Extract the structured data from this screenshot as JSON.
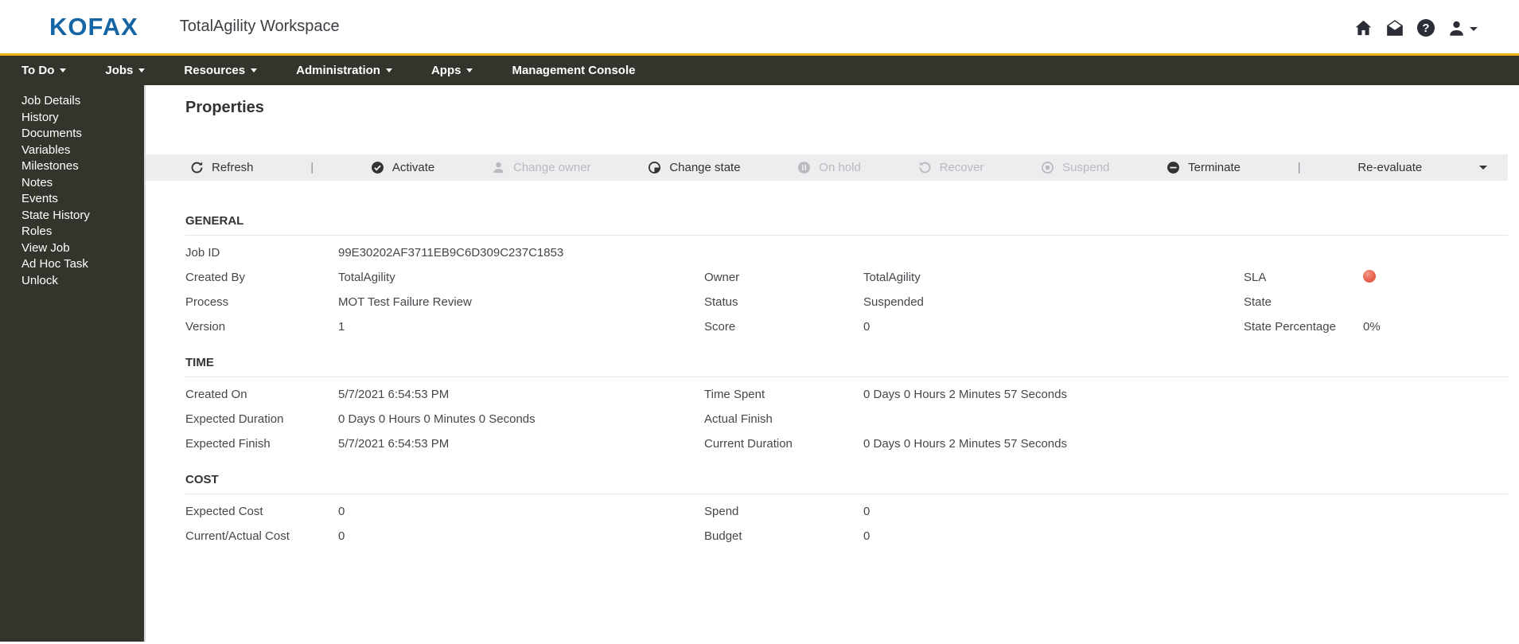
{
  "header": {
    "logo": "KOFAX",
    "title": "TotalAgility Workspace",
    "icons": [
      "home-icon",
      "mail-icon",
      "help-icon",
      "user-icon",
      "caret-down-icon"
    ],
    "help_glyph": "?"
  },
  "colors": {
    "logo_blue": "#1565a5",
    "accent_yellow": "#f0b013",
    "navbar_bg": "#34342d",
    "toolbar_bg": "#ededf0",
    "sla_red": "#e8614f"
  },
  "navbar": {
    "items": [
      {
        "label": "To Do",
        "has_caret": true
      },
      {
        "label": "Jobs",
        "has_caret": true
      },
      {
        "label": "Resources",
        "has_caret": true
      },
      {
        "label": "Administration",
        "has_caret": true
      },
      {
        "label": "Apps",
        "has_caret": true
      },
      {
        "label": "Management Console",
        "has_caret": false
      }
    ]
  },
  "sidebar": {
    "items": [
      "Job Details",
      "History",
      "Documents",
      "Variables",
      "Milestones",
      "Notes",
      "Events",
      "State History",
      "Roles",
      "View Job",
      "Ad Hoc Task",
      "Unlock"
    ]
  },
  "main": {
    "title": "Properties",
    "toolbar": {
      "separator": "|",
      "buttons": [
        {
          "label": "Refresh",
          "icon": "refresh-icon",
          "enabled": true
        },
        {
          "label": "Activate",
          "icon": "check-circle-icon",
          "enabled": true
        },
        {
          "label": "Change owner",
          "icon": "person-icon",
          "enabled": false
        },
        {
          "label": "Change state",
          "icon": "state-circle-icon",
          "enabled": true
        },
        {
          "label": "On hold",
          "icon": "pause-circle-icon",
          "enabled": false
        },
        {
          "label": "Recover",
          "icon": "undo-icon",
          "enabled": false
        },
        {
          "label": "Suspend",
          "icon": "record-circle-icon",
          "enabled": false
        },
        {
          "label": "Terminate",
          "icon": "minus-circle-icon",
          "enabled": true
        },
        {
          "label": "Re-evaluate",
          "icon": "",
          "enabled": true
        }
      ]
    },
    "sections": [
      {
        "heading": "GENERAL",
        "rows": [
          {
            "cells": [
              {
                "label": "Job ID",
                "value": "99E30202AF3711EB9C6D309C237C1853"
              },
              {
                "label": "",
                "value": ""
              },
              {
                "label": "",
                "value": ""
              }
            ]
          },
          {
            "cells": [
              {
                "label": "Created By",
                "value": "TotalAgility"
              },
              {
                "label": "Owner",
                "value": "TotalAgility"
              },
              {
                "label": "SLA",
                "value": ""
              }
            ]
          },
          {
            "cells": [
              {
                "label": "Process",
                "value": "MOT Test Failure Review"
              },
              {
                "label": "Status",
                "value": "Suspended"
              },
              {
                "label": "State",
                "value": ""
              }
            ]
          },
          {
            "cells": [
              {
                "label": "Version",
                "value": "1"
              },
              {
                "label": "Score",
                "value": "0"
              },
              {
                "label": "State Percentage",
                "value": "0%"
              }
            ]
          }
        ]
      },
      {
        "heading": "TIME",
        "rows": [
          {
            "cells": [
              {
                "label": "Created On",
                "value": "5/7/2021 6:54:53 PM"
              },
              {
                "label": "Time Spent",
                "value": "0 Days 0 Hours 2 Minutes 57 Seconds"
              },
              {
                "label": "",
                "value": ""
              }
            ]
          },
          {
            "cells": [
              {
                "label": "Expected Duration",
                "value": "0 Days 0 Hours 0 Minutes 0 Seconds"
              },
              {
                "label": "Actual Finish",
                "value": ""
              },
              {
                "label": "",
                "value": ""
              }
            ]
          },
          {
            "cells": [
              {
                "label": "Expected Finish",
                "value": "5/7/2021 6:54:53 PM"
              },
              {
                "label": "Current Duration",
                "value": "0 Days 0 Hours 2 Minutes 57 Seconds"
              },
              {
                "label": "",
                "value": ""
              }
            ]
          }
        ]
      },
      {
        "heading": "COST",
        "rows": [
          {
            "cells": [
              {
                "label": "Expected Cost",
                "value": "0"
              },
              {
                "label": "Spend",
                "value": "0"
              },
              {
                "label": "",
                "value": ""
              }
            ]
          },
          {
            "cells": [
              {
                "label": "Current/Actual Cost",
                "value": "0"
              },
              {
                "label": "Budget",
                "value": "0"
              },
              {
                "label": "",
                "value": ""
              }
            ]
          }
        ]
      }
    ]
  }
}
